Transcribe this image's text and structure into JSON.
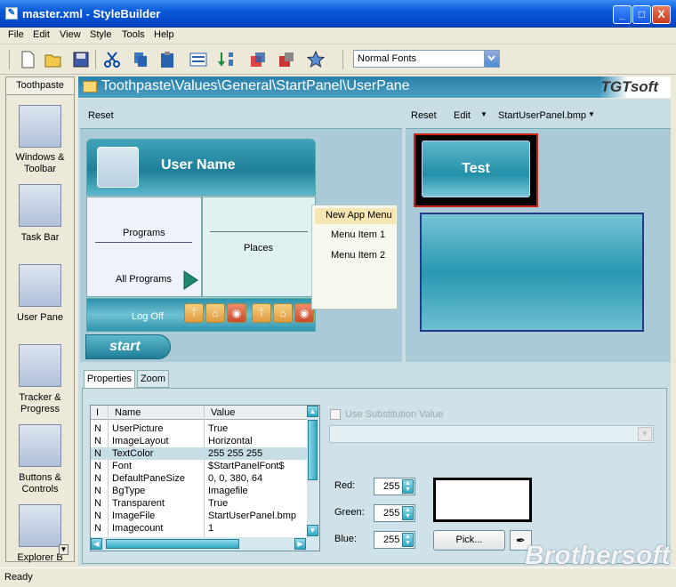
{
  "window": {
    "title": "master.xml - StyleBuilder",
    "min": "_",
    "max": "□",
    "close": "X"
  },
  "menu": [
    "File",
    "Edit",
    "View",
    "Style",
    "Tools",
    "Help"
  ],
  "toolbar": {
    "font_select": "Normal Fonts"
  },
  "sidebar": {
    "tab": "Toothpaste",
    "items": [
      {
        "label": "Windows & Toolbar"
      },
      {
        "label": "Task Bar"
      },
      {
        "label": "User Pane"
      },
      {
        "label": "Tracker & Progress"
      },
      {
        "label": "Buttons & Controls"
      },
      {
        "label": "Explorer B"
      }
    ]
  },
  "path": {
    "text": "Toothpaste\\Values\\General\\StartPanel\\UserPane",
    "logo": "TGTsoft"
  },
  "leftpane": {
    "reset": "Reset"
  },
  "rightpane": {
    "reset": "Reset",
    "edit": "Edit",
    "file": "StartUserPanel.bmp"
  },
  "startmenu": {
    "user": "User Name",
    "programs": "Programs",
    "places": "Places",
    "all_programs": "All Programs",
    "logoff": "Log Off",
    "start": "start"
  },
  "appmenu": {
    "items": [
      "New App Menu",
      "Menu Item 1",
      "Menu Item 2"
    ]
  },
  "preview": {
    "test": "Test"
  },
  "tabs": [
    "Properties",
    "Zoom"
  ],
  "grid": {
    "headers": [
      "I",
      "Name",
      "Value"
    ],
    "rows": [
      [
        "N",
        "UserPicture",
        "True"
      ],
      [
        "N",
        "ImageLayout",
        "Horizontal"
      ],
      [
        "N",
        "TextColor",
        "255 255 255"
      ],
      [
        "N",
        "Font",
        "$StartPanelFont$"
      ],
      [
        "N",
        "DefaultPaneSize",
        "0, 0, 380, 64"
      ],
      [
        "N",
        "BgType",
        "Imagefile"
      ],
      [
        "N",
        "Transparent",
        "True"
      ],
      [
        "N",
        "ImageFile",
        "StartUserPanel.bmp"
      ],
      [
        "N",
        "Imagecount",
        "1"
      ]
    ],
    "selected_row": 2
  },
  "color": {
    "use_sub": "Use Substitution Value",
    "red_label": "Red:",
    "green_label": "Green:",
    "blue_label": "Blue:",
    "red": "255",
    "green": "255",
    "blue": "255",
    "pick": "Pick..."
  },
  "watermark": "Brothersoft",
  "status": "Ready"
}
